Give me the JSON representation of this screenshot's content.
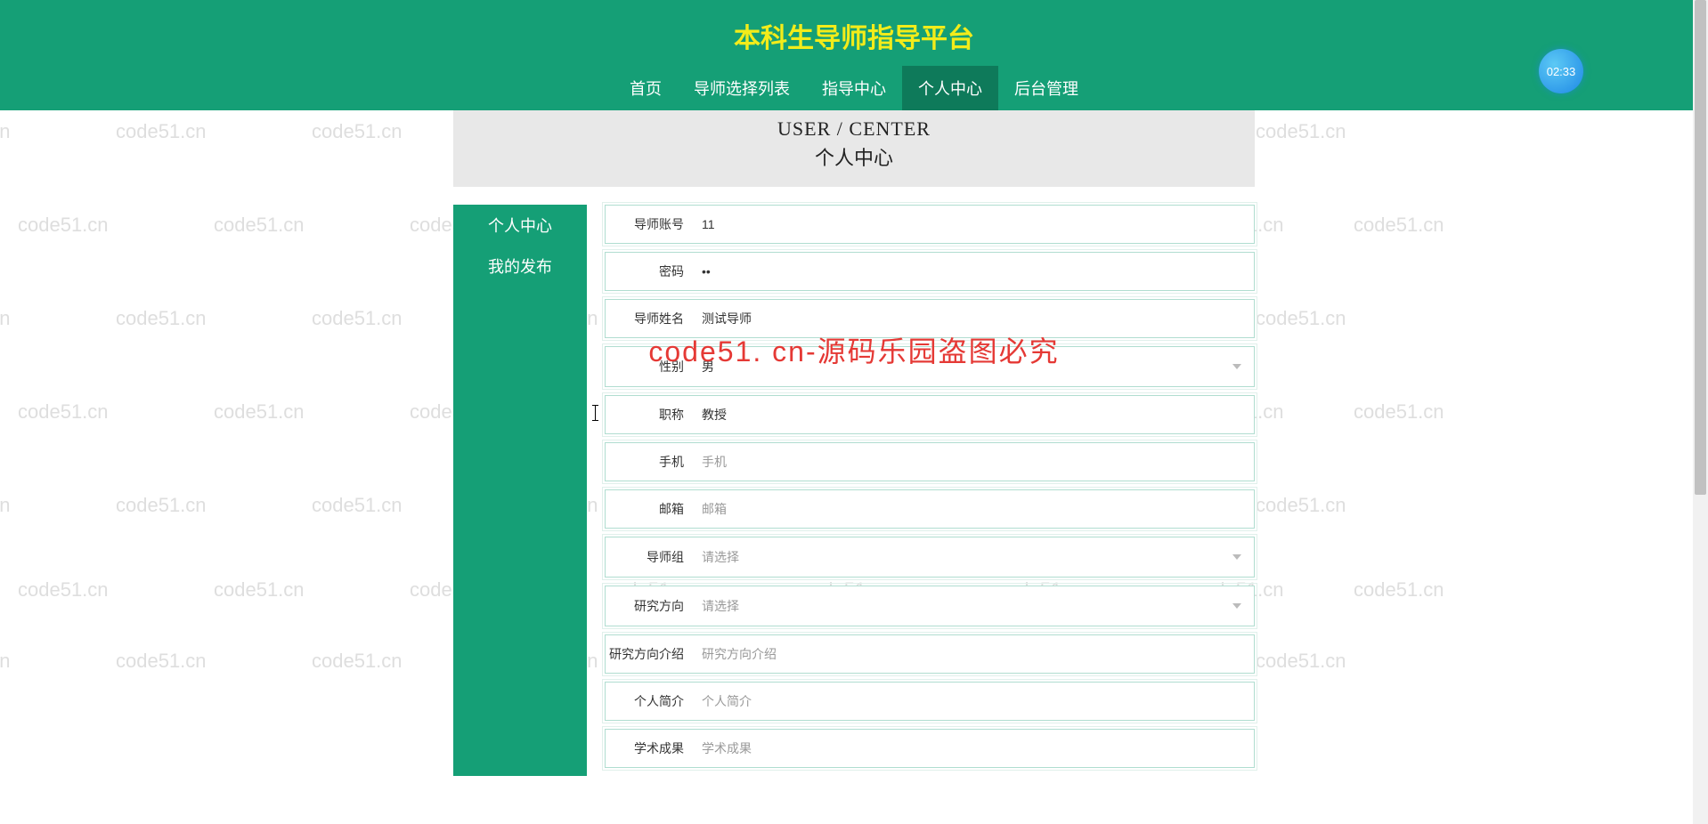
{
  "header": {
    "title": "本科生导师指导平台",
    "nav": [
      "首页",
      "导师选择列表",
      "指导中心",
      "个人中心",
      "后台管理"
    ],
    "nav_active": 3,
    "badge": "02:33"
  },
  "page_heading": {
    "en": "USER / CENTER",
    "cn": "个人中心"
  },
  "sidebar": {
    "items": [
      "个人中心",
      "我的发布"
    ],
    "active": 0
  },
  "form": {
    "fields": [
      {
        "name": "tutor-account",
        "label": "导师账号",
        "type": "text",
        "value": "11",
        "placeholder": ""
      },
      {
        "name": "password",
        "label": "密码",
        "type": "password",
        "value": "••",
        "placeholder": ""
      },
      {
        "name": "tutor-name",
        "label": "导师姓名",
        "type": "text",
        "value": "测试导师",
        "placeholder": ""
      },
      {
        "name": "gender",
        "label": "性别",
        "type": "select",
        "value": "男",
        "placeholder": ""
      },
      {
        "name": "title",
        "label": "职称",
        "type": "text",
        "value": "教授",
        "placeholder": ""
      },
      {
        "name": "phone",
        "label": "手机",
        "type": "text",
        "value": "",
        "placeholder": "手机"
      },
      {
        "name": "email",
        "label": "邮箱",
        "type": "text",
        "value": "",
        "placeholder": "邮箱"
      },
      {
        "name": "tutor-group",
        "label": "导师组",
        "type": "select",
        "value": "",
        "placeholder": "请选择"
      },
      {
        "name": "research-direction",
        "label": "研究方向",
        "type": "select",
        "value": "",
        "placeholder": "请选择"
      },
      {
        "name": "research-intro",
        "label": "研究方向介绍",
        "type": "text",
        "value": "",
        "placeholder": "研究方向介绍"
      },
      {
        "name": "personal-profile",
        "label": "个人简介",
        "type": "text",
        "value": "",
        "placeholder": "个人简介"
      },
      {
        "name": "academic-achievement",
        "label": "学术成果",
        "type": "text",
        "value": "",
        "placeholder": "学术成果"
      }
    ]
  },
  "watermark": {
    "text": "code51.cn",
    "center": "code51. cn-源码乐园盗图必究"
  }
}
